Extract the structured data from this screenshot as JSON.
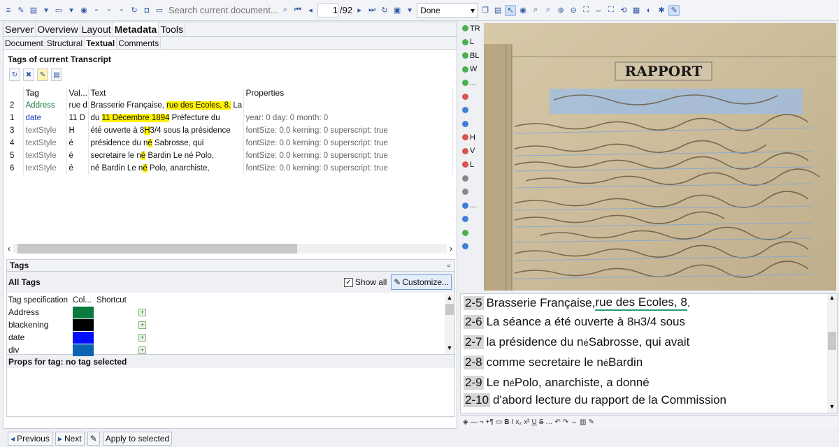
{
  "toolbar": {
    "search_placeholder": "Search current document...",
    "page_current": "1",
    "page_total": "/92",
    "status_value": "Done"
  },
  "left": {
    "tabs": [
      "Server",
      "Overview",
      "Layout",
      "Metadata",
      "Tools"
    ],
    "subtabs": [
      "Document",
      "Structural",
      "Textual",
      "Comments"
    ],
    "section_title": "Tags of current Transcript",
    "columns": [
      "Tag",
      "Val...",
      "Text",
      "Properties"
    ],
    "rows": [
      {
        "num": "2",
        "tag": "Address",
        "val": "rue d",
        "text_pre": "Brasserie Française, ",
        "text_hl": "rue des Ecoles, 8.",
        "text_post": "  La séa",
        "props": ""
      },
      {
        "num": "1",
        "tag": "date",
        "val": "11 D",
        "text_pre": "du ",
        "text_hl": "11 Décembre 1894",
        "text_post": " Préfecture du",
        "props": "year: 0 day: 0 month: 0"
      },
      {
        "num": "3",
        "tag": "textStyle",
        "val": "H",
        "text_pre": "été ouverte à 8",
        "text_hl": "H",
        "text_post": "3/4 sous la présidence",
        "props": "fontSize: 0.0 kerning: 0 superscript: true"
      },
      {
        "num": "4",
        "tag": "textStyle",
        "val": "é",
        "text_pre": "présidence du n",
        "text_hl": "é",
        "text_post": " Sabrosse, qui",
        "props": "fontSize: 0.0 kerning: 0 superscript: true"
      },
      {
        "num": "5",
        "tag": "textStyle",
        "val": "é",
        "text_pre": "secretaire le n",
        "text_hl": "é",
        "text_post": " Bardin Le né Polo,",
        "props": "fontSize: 0.0 kerning: 0 superscript: true"
      },
      {
        "num": "6",
        "tag": "textStyle",
        "val": "é",
        "text_pre": "né Bardin Le n",
        "text_hl": "é",
        "text_post": " Polo, anarchiste,",
        "props": "fontSize: 0.0 kerning: 0 superscript: true"
      }
    ],
    "tags_header": "Tags",
    "all_tags": "All Tags",
    "show_all": "Show all",
    "customize": "Customize...",
    "spec_columns": [
      "Tag specification",
      "Col...",
      "Shortcut"
    ],
    "spec_rows": [
      {
        "name": "Address",
        "color": "#0a7a3e"
      },
      {
        "name": "blackening",
        "color": "#000000"
      },
      {
        "name": "date",
        "color": "#0010ff"
      },
      {
        "name": "div",
        "color": "#0a64b4"
      }
    ],
    "props_for_tag": "Props for tag: no tag selected",
    "buttons": {
      "previous": "Previous",
      "next": "Next",
      "apply": "Apply to selected"
    }
  },
  "vtools": [
    "TR",
    "L",
    "BL",
    "W",
    "...",
    "",
    "",
    "",
    "H",
    "V",
    "L",
    "",
    "",
    "...",
    "",
    "",
    ""
  ],
  "image": {
    "heading": "RAPPORT"
  },
  "transcript": {
    "lines": [
      {
        "num": "2-5",
        "pre": "Brasserie Française, ",
        "u": "rue des Ecoles, 8",
        "post": "."
      },
      {
        "num": "2-6",
        "pre": "La séance a été ouverte à 8",
        "sup": "H",
        "post": "3/4 sous"
      },
      {
        "num": "2-7",
        "pre": "la présidence du n",
        "sup": "é",
        "post": " Sabrosse, qui avait"
      },
      {
        "num": "2-8",
        "pre": "comme secretaire le n",
        "sup": "é",
        "post": " Bardin"
      },
      {
        "num": "2-9",
        "pre": "Le n",
        "sup": "é",
        "post": " Polo, anarchiste, a donné"
      },
      {
        "num": "2-10",
        "pre": "d'abord lecture du rapport de la Commission",
        "post": ""
      }
    ]
  }
}
